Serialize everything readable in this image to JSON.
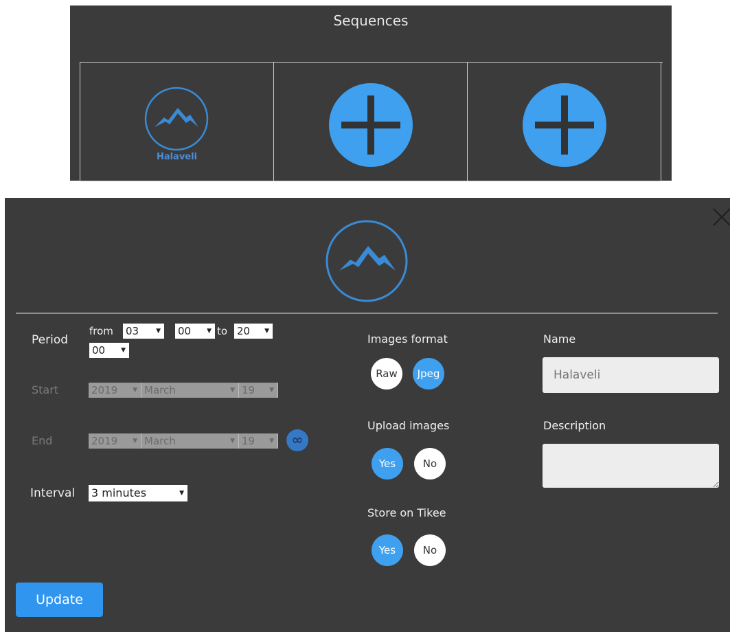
{
  "sequences": {
    "title": "Sequences",
    "items": [
      {
        "name": "Halaveli",
        "icon": "mountain-icon"
      },
      {
        "icon": "plus-icon"
      },
      {
        "icon": "plus-icon"
      }
    ]
  },
  "dialog": {
    "period": {
      "label": "Period",
      "from_label": "from",
      "from_hour": "03",
      "from_minute": "00",
      "to_label": "to",
      "to_hour": "20",
      "to_minute": "00"
    },
    "start": {
      "label": "Start",
      "year": "2019",
      "month": "March",
      "day": "19"
    },
    "end": {
      "label": "End",
      "year": "2019",
      "month": "March",
      "day": "19",
      "infinity_symbol": "∞"
    },
    "interval": {
      "label": "Interval",
      "value": "3 minutes"
    },
    "images_format": {
      "label": "Images format",
      "options": [
        "Raw",
        "Jpeg"
      ],
      "selected": "Jpeg"
    },
    "upload_images": {
      "label": "Upload images",
      "options": [
        "Yes",
        "No"
      ],
      "selected": "Yes"
    },
    "store_on_tikee": {
      "label": "Store on Tikee",
      "options": [
        "Yes",
        "No"
      ],
      "selected": "Yes"
    },
    "name": {
      "label": "Name",
      "placeholder": "Halaveli"
    },
    "description": {
      "label": "Description",
      "value": ""
    },
    "update_label": "Update"
  },
  "colors": {
    "panel_bg": "#3b3b3b",
    "accent": "#3fa0ef",
    "logo_blue": "#3a8bd6"
  }
}
